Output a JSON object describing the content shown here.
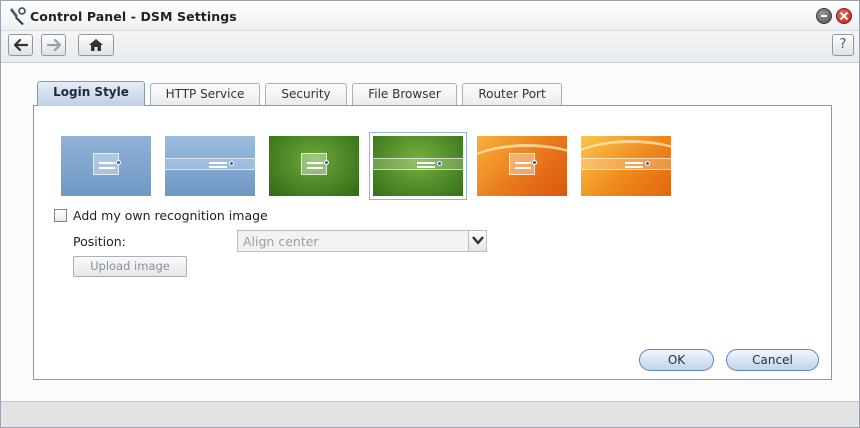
{
  "window": {
    "title": "Control Panel - DSM Settings"
  },
  "toolbar": {
    "back_icon": "arrow-left-icon",
    "forward_icon": "arrow-right-icon",
    "home_icon": "home-icon",
    "help_label": "?"
  },
  "tabs": [
    {
      "label": "Login Style",
      "active": true
    },
    {
      "label": "HTTP Service",
      "active": false
    },
    {
      "label": "Security",
      "active": false
    },
    {
      "label": "File Browser",
      "active": false
    },
    {
      "label": "Router Port",
      "active": false
    }
  ],
  "login_style": {
    "themes": [
      {
        "name": "blue-classic",
        "selected": false
      },
      {
        "name": "blue-band",
        "selected": false
      },
      {
        "name": "green-classic",
        "selected": false
      },
      {
        "name": "green-band",
        "selected": true
      },
      {
        "name": "orange-classic",
        "selected": false
      },
      {
        "name": "orange-band",
        "selected": false
      }
    ],
    "recognition_checkbox_label": "Add my own recognition image",
    "recognition_checked": false,
    "position_label": "Position:",
    "position_value": "Align center",
    "upload_label": "Upload image"
  },
  "actions": {
    "ok_label": "OK",
    "cancel_label": "Cancel"
  },
  "colors": {
    "accent_blue": "#7f9cbb",
    "close_red": "#c0392b"
  }
}
